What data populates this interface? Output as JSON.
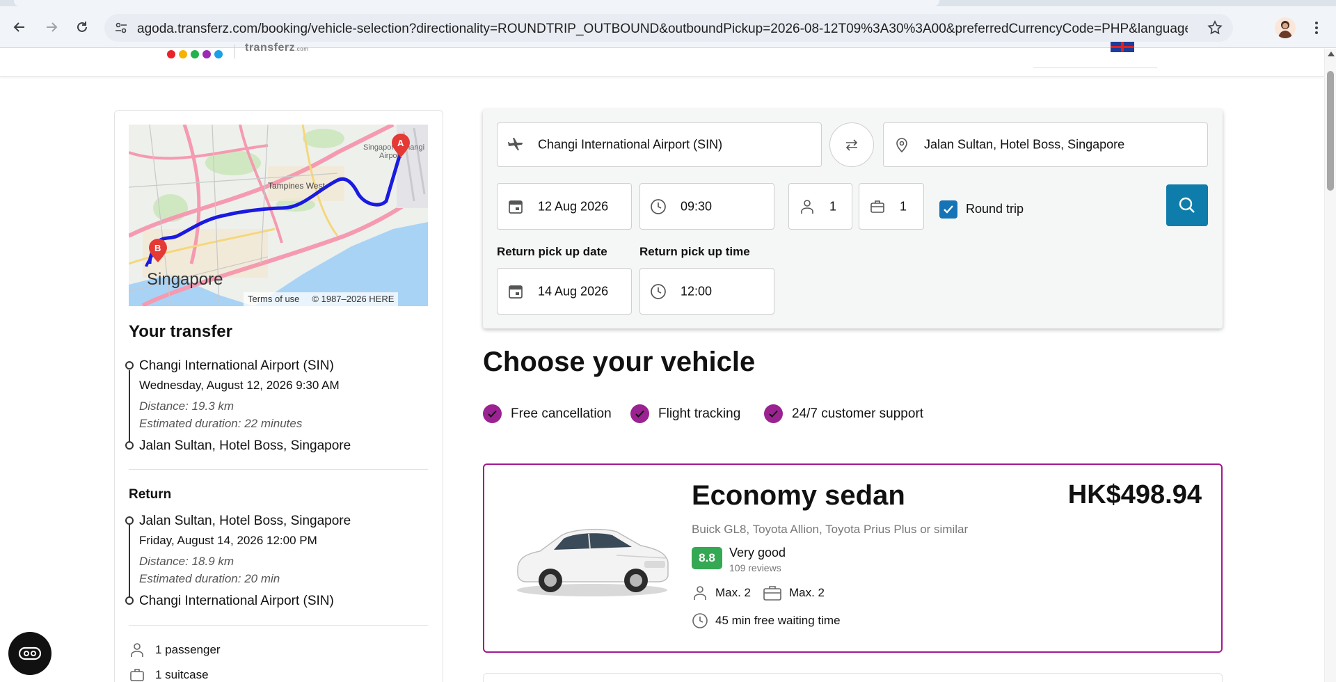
{
  "browser": {
    "url": "agoda.transferz.com/booking/vehicle-selection?directionality=ROUNDTRIP_OUTBOUND&outboundPickup=2026-08-12T09%3A30%3A00&preferredCurrencyCode=PHP&language=en-us&utm_campai..."
  },
  "brand": {
    "logo_text": "transferz",
    "logo_suffix": ".com",
    "dot_colors": [
      "#e8232a",
      "#f5b400",
      "#22b14c",
      "#9b2ab5",
      "#1aa0e6"
    ]
  },
  "map": {
    "labels": [
      "Singapore Changi Airport",
      "Tampines West",
      "Singapore"
    ],
    "marker_a": "A",
    "marker_b": "B",
    "terms": "Terms of use",
    "copyright": "© 1987–2026 HERE"
  },
  "summary": {
    "title": "Your transfer",
    "outbound": {
      "from": "Changi International Airport (SIN)",
      "datetime": "Wednesday, August 12, 2026 9:30 AM",
      "distance": "Distance: 19.3 km",
      "duration": "Estimated duration: 22 minutes",
      "to": "Jalan Sultan, Hotel Boss, Singapore"
    },
    "return_title": "Return",
    "return": {
      "from": "Jalan Sultan, Hotel Boss, Singapore",
      "datetime": "Friday, August 14, 2026 12:00 PM",
      "distance": "Distance: 18.9 km",
      "duration": "Estimated duration: 20 min",
      "to": "Changi International Airport (SIN)"
    },
    "passengers": "1 passenger",
    "suitcases": "1 suitcase"
  },
  "search": {
    "pickup": "Changi International Airport (SIN)",
    "dropoff": "Jalan Sultan, Hotel Boss, Singapore",
    "date": "12 Aug 2026",
    "time": "09:30",
    "passengers": "1",
    "luggage": "1",
    "round_trip_label": "Round trip",
    "round_trip_checked": true,
    "return_date_label": "Return pick up date",
    "return_time_label": "Return pick up time",
    "return_date": "14 Aug 2026",
    "return_time": "12:00"
  },
  "main": {
    "title": "Choose your vehicle",
    "features": [
      "Free cancellation",
      "Flight tracking",
      "24/7 customer support"
    ]
  },
  "vehicle": {
    "name": "Economy sedan",
    "price": "HK$498.94",
    "models": "Buick GL8, Toyota Allion, Toyota Prius Plus or similar",
    "score": "8.8",
    "rating_label": "Very good",
    "reviews": "109 reviews",
    "max_passengers": "Max. 2",
    "max_luggage": "Max. 2",
    "waiting": "45 min free waiting time"
  },
  "colors": {
    "accent_purple": "#a21792",
    "search_blue": "#0e7dab",
    "checkbox_blue": "#1673b5",
    "score_green": "#34a853",
    "route_blue": "#1a1ae0"
  }
}
